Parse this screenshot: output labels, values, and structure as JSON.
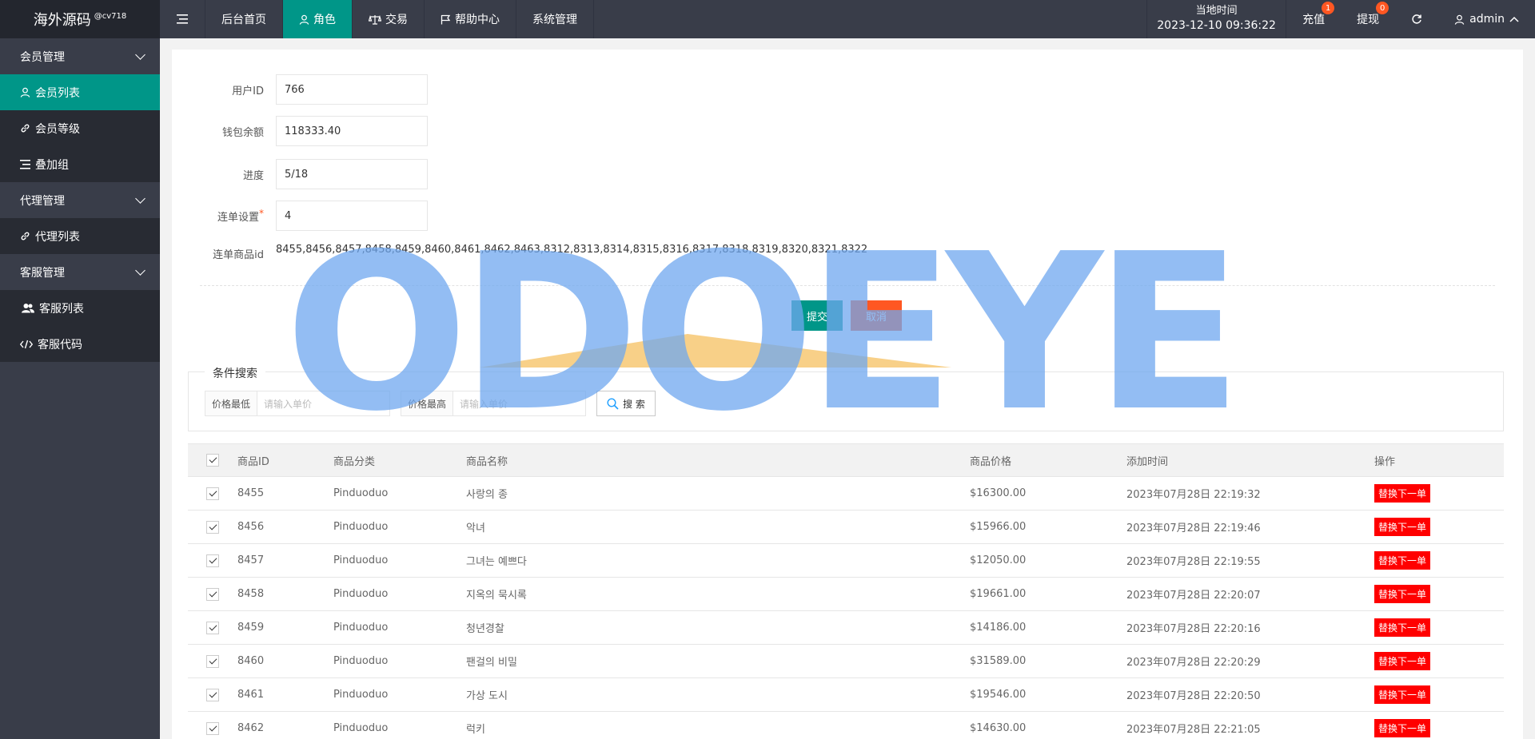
{
  "header": {
    "logo": "海外源码",
    "logo_sub": "@cv718",
    "nav": [
      "后台首页",
      "角色",
      "交易",
      "帮助中心",
      "系统管理"
    ],
    "clock_label": "当地时间",
    "clock_value": "2023-12-10 09:36:22",
    "recharge": {
      "label": "充值",
      "count": "1"
    },
    "withdraw": {
      "label": "提现",
      "count": "0"
    },
    "user": "admin"
  },
  "sidebar": {
    "member_group": "会员管理",
    "member_list": "会员列表",
    "member_level": "会员等级",
    "stack_group": "叠加组",
    "agent_group": "代理管理",
    "agent_list": "代理列表",
    "service_group": "客服管理",
    "service_list": "客服列表",
    "service_code": "客服代码"
  },
  "form": {
    "user_id_label": "用户ID",
    "user_id": "766",
    "balance_label": "钱包余额",
    "balance": "118333.40",
    "progress_label": "进度",
    "progress": "5/18",
    "combo_label": "连单设置",
    "combo": "4",
    "combo_ids_label": "连单商品id",
    "combo_ids": "8455,8456,8457,8458,8459,8460,8461,8462,8463,8312,8313,8314,8315,8316,8317,8318,8319,8320,8321,8322",
    "submit": "提交",
    "cancel": "取消"
  },
  "search": {
    "legend": "条件搜索",
    "min_label": "价格最低",
    "min_placeholder": "请输入单价",
    "max_label": "价格最高",
    "max_placeholder": "请输入单价",
    "button": "搜 索"
  },
  "table": {
    "headers": [
      "商品ID",
      "商品分类",
      "商品名称",
      "商品价格",
      "添加时间",
      "操作"
    ],
    "rows": [
      {
        "id": "8455",
        "cat": "Pinduoduo",
        "name": "사랑의 종",
        "price": "$16300.00",
        "time": "2023年07月28日 22:19:32",
        "op": "替换下一单"
      },
      {
        "id": "8456",
        "cat": "Pinduoduo",
        "name": "악녀",
        "price": "$15966.00",
        "time": "2023年07月28日 22:19:46",
        "op": "替换下一单"
      },
      {
        "id": "8457",
        "cat": "Pinduoduo",
        "name": "그녀는 예쁘다",
        "price": "$12050.00",
        "time": "2023年07月28日 22:19:55",
        "op": "替换下一单"
      },
      {
        "id": "8458",
        "cat": "Pinduoduo",
        "name": "지옥의 묵시록",
        "price": "$19661.00",
        "time": "2023年07月28日 22:20:07",
        "op": "替换下一单"
      },
      {
        "id": "8459",
        "cat": "Pinduoduo",
        "name": "청년경찰",
        "price": "$14186.00",
        "time": "2023年07月28日 22:20:16",
        "op": "替换下一单"
      },
      {
        "id": "8460",
        "cat": "Pinduoduo",
        "name": "팬걸의 비밀",
        "price": "$31589.00",
        "time": "2023年07月28日 22:20:29",
        "op": "替换下一单"
      },
      {
        "id": "8461",
        "cat": "Pinduoduo",
        "name": "가상 도시",
        "price": "$19546.00",
        "time": "2023年07月28日 22:20:50",
        "op": "替换下一单"
      },
      {
        "id": "8462",
        "cat": "Pinduoduo",
        "name": "럭키",
        "price": "$14630.00",
        "time": "2023年07月28日 22:21:05",
        "op": "替换下一单"
      }
    ]
  },
  "watermark": "ODOEYE"
}
